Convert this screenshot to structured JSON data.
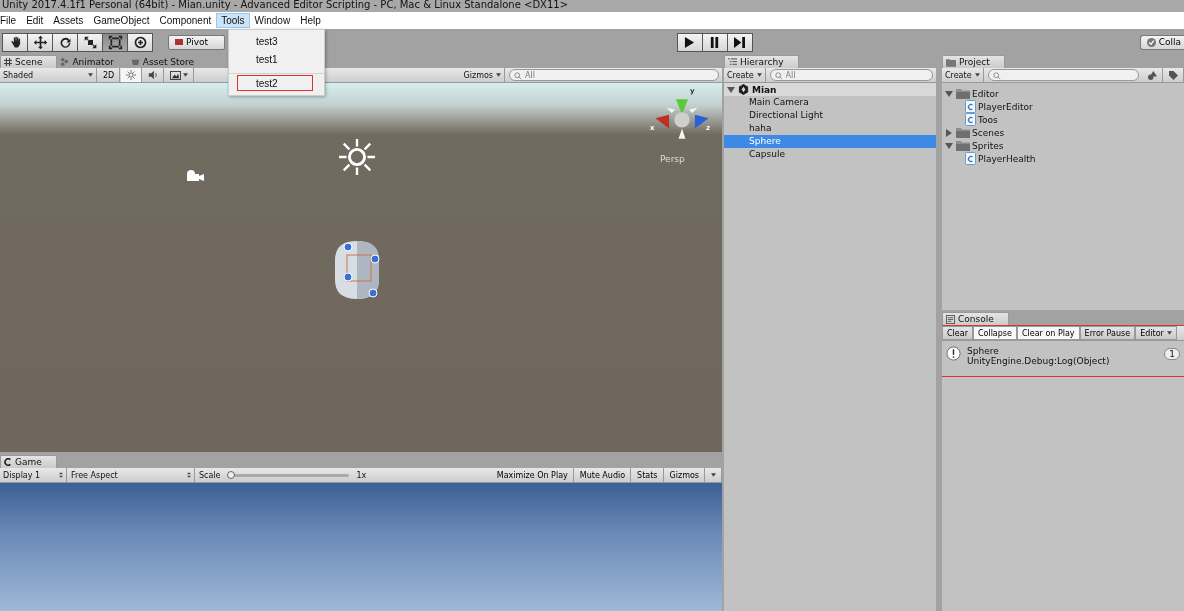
{
  "window": {
    "title": "Unity 2017.4.1f1 Personal (64bit) - Mian.unity - Advanced Editor Scripting - PC, Mac & Linux Standalone <DX11>"
  },
  "menu": [
    {
      "label": "File",
      "selected": false
    },
    {
      "label": "Edit",
      "selected": false
    },
    {
      "label": "Assets",
      "selected": false
    },
    {
      "label": "GameObject",
      "selected": false
    },
    {
      "label": "Component",
      "selected": false
    },
    {
      "label": "Tools",
      "selected": true
    },
    {
      "label": "Window",
      "selected": false
    },
    {
      "label": "Help",
      "selected": false
    }
  ],
  "tools_menu": [
    {
      "label": "test3",
      "separator_before": false,
      "highlighted": false
    },
    {
      "label": "test1",
      "separator_before": false,
      "highlighted": false
    },
    {
      "label": "test2",
      "separator_before": true,
      "highlighted": true
    }
  ],
  "toolbar": {
    "tools": [
      {
        "kind": "hand",
        "selected": false
      },
      {
        "kind": "move",
        "selected": false
      },
      {
        "kind": "rotate",
        "selected": false
      },
      {
        "kind": "scale",
        "selected": false
      },
      {
        "kind": "rect",
        "selected": true
      },
      {
        "kind": "transform",
        "selected": false
      }
    ],
    "pivot": "Pivot",
    "right_button": "Colla"
  },
  "scene": {
    "tabs": [
      {
        "label": "Scene",
        "kind": "scene",
        "selected": true
      },
      {
        "label": "Animator",
        "kind": "animator",
        "selected": false
      },
      {
        "label": "Asset Store",
        "kind": "store",
        "selected": false
      }
    ],
    "shading": "Shaded",
    "mode_2d": "2D",
    "lighting_on": true,
    "audio_on": false,
    "gizmos": "Gizmos",
    "search_placeholder": "All",
    "axes": {
      "y": "y",
      "x": "x",
      "z": "z"
    },
    "projection": "Persp"
  },
  "game": {
    "tab": "Game",
    "display": "Display 1",
    "aspect": "Free Aspect",
    "scale_label": "Scale",
    "scale": {
      "level": 0.0
    },
    "scale_value": "1x",
    "buttons": [
      {
        "label": "Maximize On Play",
        "selected": false
      },
      {
        "label": "Mute Audio",
        "selected": false
      },
      {
        "label": "Stats",
        "selected": false
      },
      {
        "label": "Gizmos",
        "selected": false
      }
    ]
  },
  "hierarchy": {
    "tab": "Hierarchy",
    "create": "Create",
    "search_placeholder": "All",
    "scene": "Mian",
    "items": [
      {
        "label": "Main Camera",
        "selected": false
      },
      {
        "label": "Directional Light",
        "selected": false
      },
      {
        "label": "haha",
        "selected": false
      },
      {
        "label": "Sphere",
        "selected": true
      },
      {
        "label": "Capsule",
        "selected": false
      }
    ]
  },
  "project": {
    "tab": "Project",
    "create": "Create",
    "tree": [
      {
        "label": "Editor",
        "kind": "folder",
        "expanded": true,
        "children": [
          {
            "label": "PlayerEditor",
            "kind": "script"
          },
          {
            "label": "Toos",
            "kind": "script"
          }
        ]
      },
      {
        "label": "Scenes",
        "kind": "folder",
        "expanded": false
      },
      {
        "label": "Sprites",
        "kind": "folder",
        "expanded": true,
        "children": [
          {
            "label": "PlayerHealth",
            "kind": "script"
          }
        ]
      }
    ]
  },
  "console": {
    "tab": "Console",
    "buttons": [
      {
        "label": "Clear",
        "selected": false
      },
      {
        "label": "Collapse",
        "selected": true
      },
      {
        "label": "Clear on Play",
        "selected": true
      },
      {
        "label": "Error Pause",
        "selected": false
      },
      {
        "label": "Editor",
        "selected": false
      }
    ],
    "entries": [
      {
        "message": "Sphere",
        "trace": "UnityEngine.Debug:Log(Object)",
        "count": "1"
      }
    ],
    "highlighted": true
  }
}
